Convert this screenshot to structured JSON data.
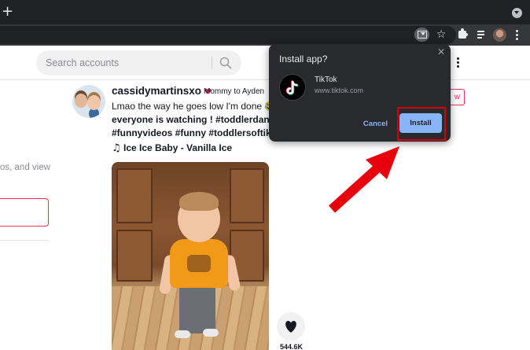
{
  "browser": {
    "new_tab_label": "+",
    "icons": [
      "install-app-icon",
      "star-icon",
      "puzzle-icon",
      "reading-list-icon",
      "profile-avatar",
      "kebab-icon"
    ]
  },
  "header": {
    "search": {
      "placeholder": "Search accounts"
    }
  },
  "sidebar": {
    "text_fragment": "os, and view"
  },
  "post": {
    "username": "cassidymartinsxo",
    "nickname": "Mommy to Ayden",
    "caption_lines": [
      "Lmao the way he goes low I'm done 😂",
      "everyone is watching ! #toddlerdance #",
      "#funnyvideos #funny #toddlersoftiktok"
    ],
    "music_icon": "♫",
    "music": "Ice Ice Baby - Vanilla Ice",
    "follow_label": "w",
    "like_count": "544.6K"
  },
  "dialog": {
    "title": "Install app?",
    "close_glyph": "✕",
    "app_name": "TikTok",
    "app_url": "www.tiktok.com",
    "cancel_label": "Cancel",
    "install_label": "Install"
  },
  "colors": {
    "accent_blue": "#8ab4f8",
    "tiktok_red": "#fe2c55",
    "annotation_red": "#e8000c",
    "dialog_bg": "#292a2d"
  }
}
